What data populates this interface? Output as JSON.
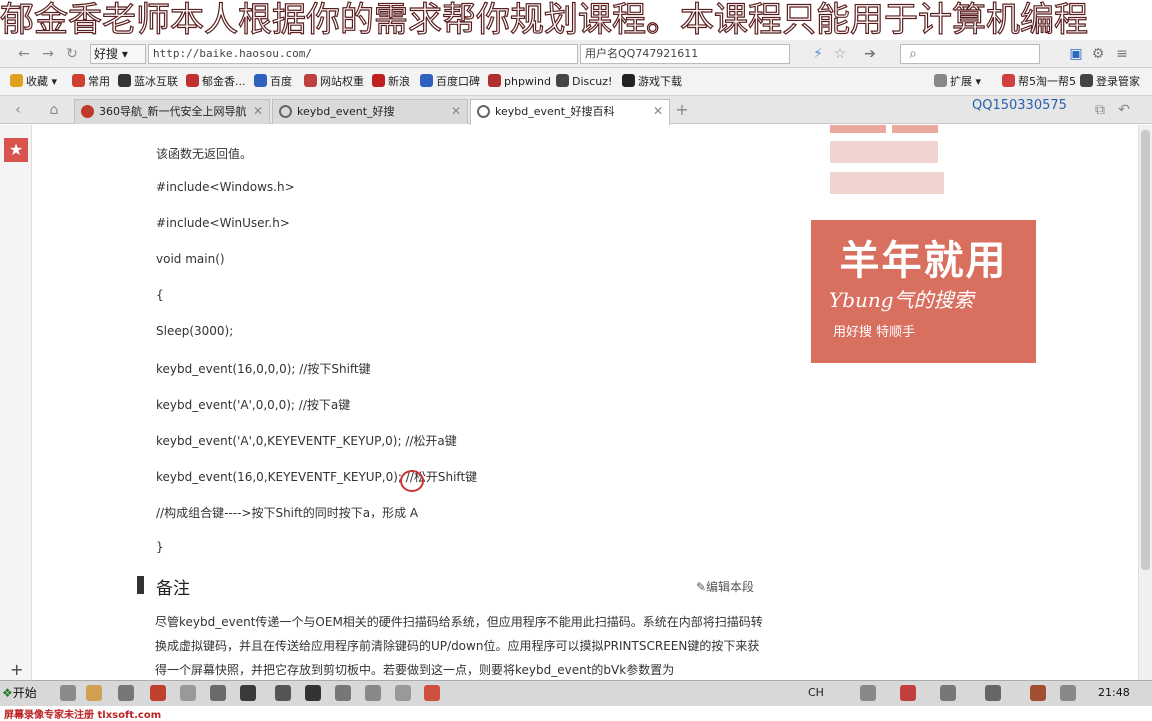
{
  "banner": {
    "text": "郁金香老师本人根据你的需求帮你规划课程。本课程只能用于计算机编程"
  },
  "address_bar": {
    "engine": "好搜",
    "url": "http://baike.haosou.com/",
    "user_label": "用户名QQ747921611"
  },
  "bookmarks": [
    {
      "label": "收藏",
      "color": "#e0a020"
    },
    {
      "label": "常用",
      "color": "#d04030"
    },
    {
      "label": "蓝冰互联",
      "color": "#333333"
    },
    {
      "label": "郁金香...",
      "color": "#c03030"
    },
    {
      "label": "百度",
      "color": "#3060c0"
    },
    {
      "label": "网站权重",
      "color": "#c04040"
    },
    {
      "label": "新浪",
      "color": "#c02020"
    },
    {
      "label": "百度口碑",
      "color": "#3060c0"
    },
    {
      "label": "phpwind",
      "color": "#b03030"
    },
    {
      "label": "Discuz!",
      "color": "#444444"
    },
    {
      "label": "游戏下载",
      "color": "#222222"
    },
    {
      "label": "扩展",
      "color": "#888888"
    },
    {
      "label": "帮5淘一帮5",
      "color": "#d04040"
    },
    {
      "label": "登录管家",
      "color": "#444444"
    }
  ],
  "tabs": [
    {
      "label": "360导航_新一代安全上网导航",
      "active": false
    },
    {
      "label": "keybd_event_好搜",
      "active": false
    },
    {
      "label": "keybd_event_好搜百科",
      "active": true
    }
  ],
  "qq_number": "QQ150330575",
  "content": {
    "lines": [
      "该函数无返回值。",
      "#include<Windows.h>",
      "#include<WinUser.h>",
      "void main()",
      "{",
      "Sleep(3000);",
      "keybd_event(16,0,0,0); //按下Shift键",
      "keybd_event('A',0,0,0); //按下a键",
      "keybd_event('A',0,KEYEVENTF_KEYUP,0); //松开a键",
      "keybd_event(16,0,KEYEVENTF_KEYUP,0); //松开Shift键",
      "//构成组合键---->按下Shift的同时按下a，形成 A",
      "}"
    ],
    "notes_title": "备注",
    "edit_link": "✎编辑本段",
    "paragraph": [
      "尽管keybd_event传递一个与OEM相关的硬件扫描码给系统，但应用程序不能用此扫描码。系统在内部将扫描码转",
      "换成虚拟键码，并且在传送给应用程序前清除键码的UP/down位。应用程序可以摸拟PRINTSCREEN键的按下来获",
      "得一个屏幕快照，并把它存放到剪切板中。若要做到这一点，则要将keybd_event的bVk参数置为"
    ]
  },
  "ad": {
    "headline": "羊年就用",
    "sub": "Ybung气的搜索",
    "foot": "用好搜 特顺手"
  },
  "taskbar": {
    "start": "开始",
    "time": "21:48"
  },
  "watermark": "屏幕录像专家未注册 tlxsoft.com"
}
